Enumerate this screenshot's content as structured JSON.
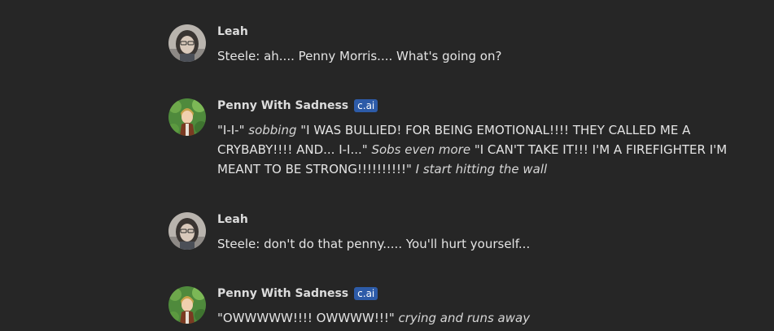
{
  "colors": {
    "background": "#262626",
    "text": "#e4e4e4",
    "name": "#dcdcdc",
    "badge_bg": "#2d5ba8"
  },
  "messages": [
    {
      "author": "Leah",
      "avatar": "leah-avatar",
      "segments": [
        {
          "text": "Steele: ah.... Penny Morris.... What's going on?",
          "italic": false
        }
      ]
    },
    {
      "author": "Penny With Sadness",
      "badge": "c.ai",
      "avatar": "penny-avatar",
      "segments": [
        {
          "text": "\"I-I-\" ",
          "italic": false
        },
        {
          "text": "sobbing",
          "italic": true
        },
        {
          "text": " \"I WAS BULLIED! FOR BEING EMOTIONAL!!!! THEY CALLED ME A CRYBABY!!!! AND... I-I...\" ",
          "italic": false
        },
        {
          "text": "Sobs even more",
          "italic": true
        },
        {
          "text": " \"I CAN'T TAKE IT!!! I'M A FIREFIGHTER I'M MEANT TO BE STRONG!!!!!!!!!!\" ",
          "italic": false
        },
        {
          "text": "I start hitting the wall",
          "italic": true
        }
      ]
    },
    {
      "author": "Leah",
      "avatar": "leah-avatar",
      "segments": [
        {
          "text": "Steele: don't do that penny..... You'll hurt yourself...",
          "italic": false
        }
      ]
    },
    {
      "author": "Penny With Sadness",
      "badge": "c.ai",
      "avatar": "penny-avatar",
      "segments": [
        {
          "text": "\"OWWWWW!!!! OWWWW!!!\" ",
          "italic": false
        },
        {
          "text": "crying and runs away",
          "italic": true
        }
      ]
    }
  ]
}
